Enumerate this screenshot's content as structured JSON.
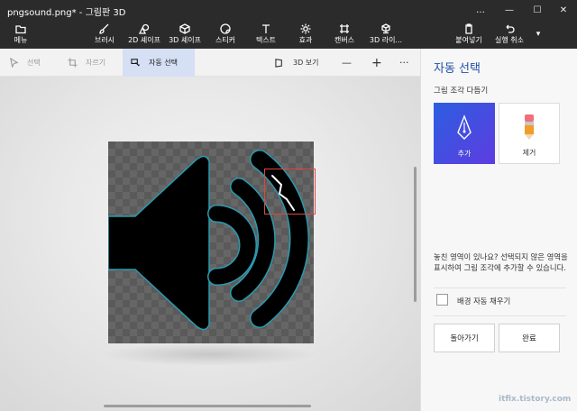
{
  "titlebar": {
    "title": "pngsound.png* - 그림판 3D",
    "controls": [
      "…",
      "—",
      "☐",
      "✕"
    ]
  },
  "ribbon": {
    "menu": "메뉴",
    "brushes": "브러시",
    "shapes2d": "2D 셰이프",
    "shapes3d": "3D 셰이프",
    "stickers": "스티커",
    "text": "텍스트",
    "effects": "효과",
    "canvas": "캔버스",
    "library3d": "3D 라이...",
    "paste": "붙여넣기",
    "undo": "실행 취소",
    "more": "▾"
  },
  "toolbar": {
    "select": "선택",
    "crop": "자르기",
    "magic_select": "자동 선택",
    "view3d": "3D 보기",
    "zoom_out": "—",
    "zoom_in": "+",
    "more": "···"
  },
  "panel": {
    "title": "자동 선택",
    "subtitle": "그림 조각 다듬기",
    "add": "추가",
    "remove": "제거",
    "hint": "놓친 영역이 있나요? 선택되지 않은 영역을 표시하여 그림 조각에 추가할 수 있습니다.",
    "autofill": "배경 자동 채우기",
    "autofill_checked": false,
    "back": "돌아가기",
    "done": "완료"
  },
  "colors": {
    "accent": "#1e4fa8",
    "dark_bar": "#2b2b2b",
    "highlight": "#e2453c",
    "selection_outline": "#2a9bb0"
  },
  "watermark": "itfix.tistory.com"
}
